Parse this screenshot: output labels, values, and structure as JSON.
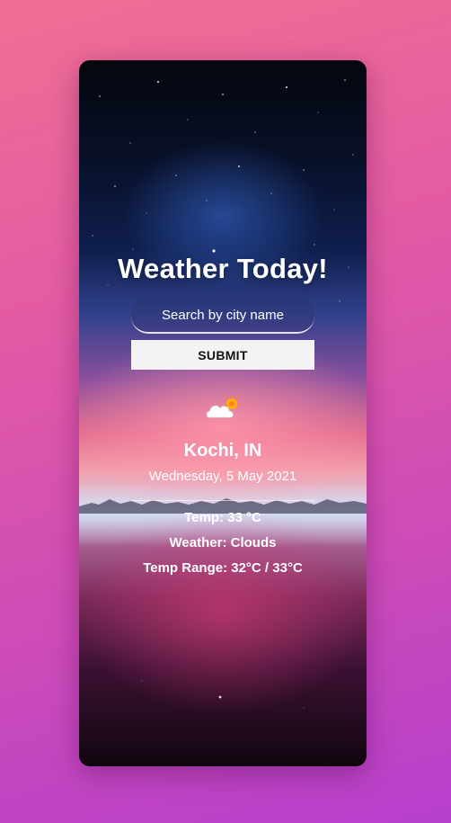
{
  "app": {
    "title": "Weather Today!"
  },
  "search": {
    "placeholder": "Search by city name",
    "value": ""
  },
  "submit": {
    "label": "SUBMIT"
  },
  "weather": {
    "icon": "sun-behind-cloud-icon",
    "city": "Kochi, IN",
    "date": "Wednesday, 5 May 2021",
    "temp_text": "Temp: 33 °C",
    "condition_text": "Weather: Clouds",
    "range_text": "Temp Range: 32°C / 33°C"
  },
  "colors": {
    "page_gradient_start": "#ef6f93",
    "page_gradient_end": "#b63fcc",
    "button_background": "#f3f3f3",
    "text": "#ffffff"
  }
}
